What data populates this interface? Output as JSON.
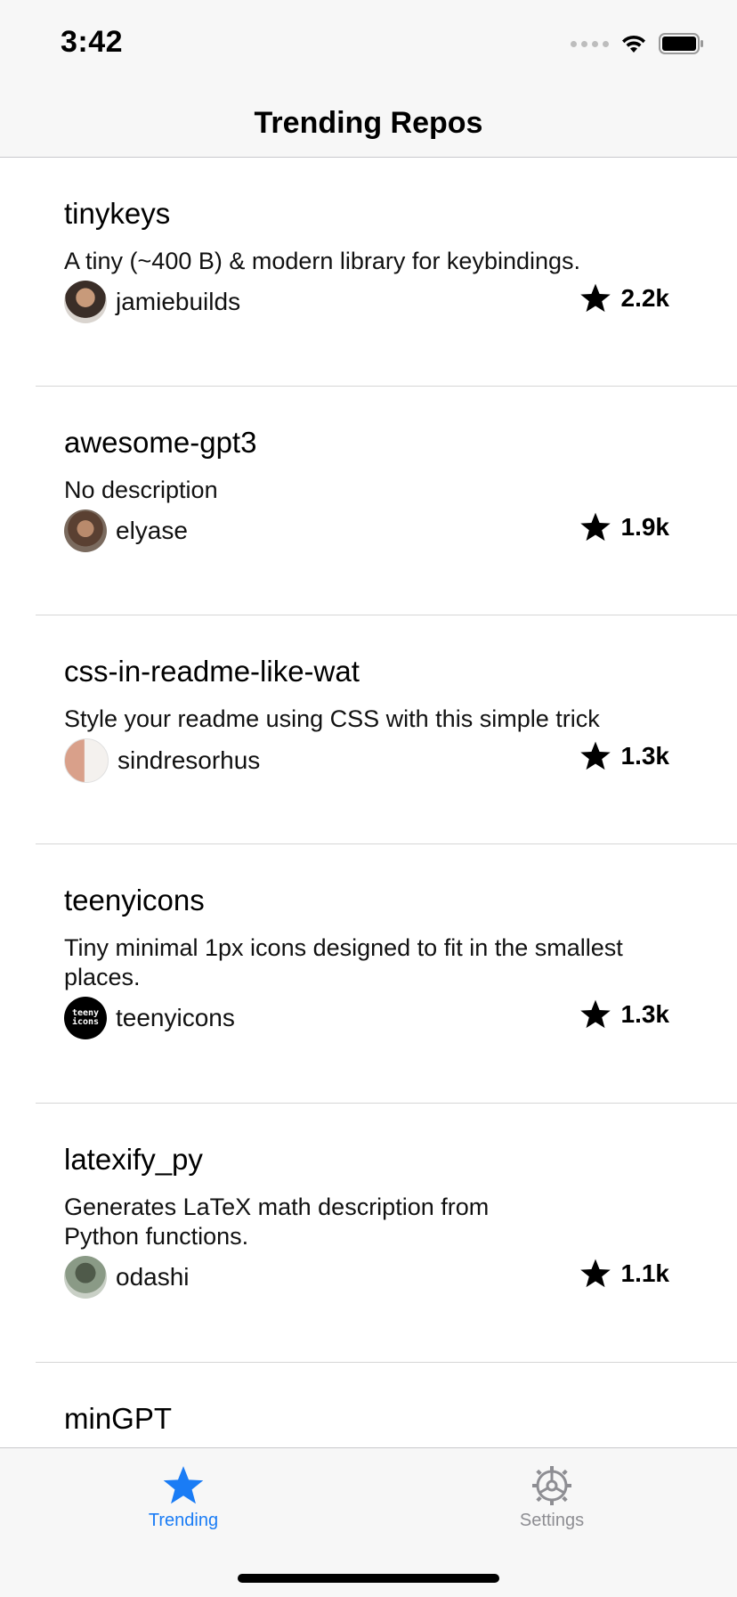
{
  "status": {
    "time": "3:42"
  },
  "nav": {
    "title": "Trending Repos"
  },
  "repos": [
    {
      "name": "tinykeys",
      "description": "A tiny (~400 B) & modern library for keybindings.",
      "owner": "jamiebuilds",
      "stars": "2.2k"
    },
    {
      "name": "awesome-gpt3",
      "description": "No description",
      "owner": "elyase",
      "stars": "1.9k"
    },
    {
      "name": "css-in-readme-like-wat",
      "description": "Style your readme using CSS with this simple trick",
      "owner": "sindresorhus",
      "stars": "1.3k"
    },
    {
      "name": "teenyicons",
      "description": "Tiny minimal 1px icons designed to fit in the smallest places.",
      "owner": "teenyicons",
      "stars": "1.3k",
      "avatar_text": "teeny icons"
    },
    {
      "name": "latexify_py",
      "description": "Generates LaTeX math description from Python functions.",
      "owner": "odashi",
      "stars": "1.1k"
    },
    {
      "name": "minGPT"
    }
  ],
  "tabs": [
    {
      "label": "Trending",
      "icon": "star-icon",
      "active": true
    },
    {
      "label": "Settings",
      "icon": "gear-icon",
      "active": false
    }
  ],
  "colors": {
    "accent": "#1a7cf5",
    "inactive": "#8e8e93"
  }
}
